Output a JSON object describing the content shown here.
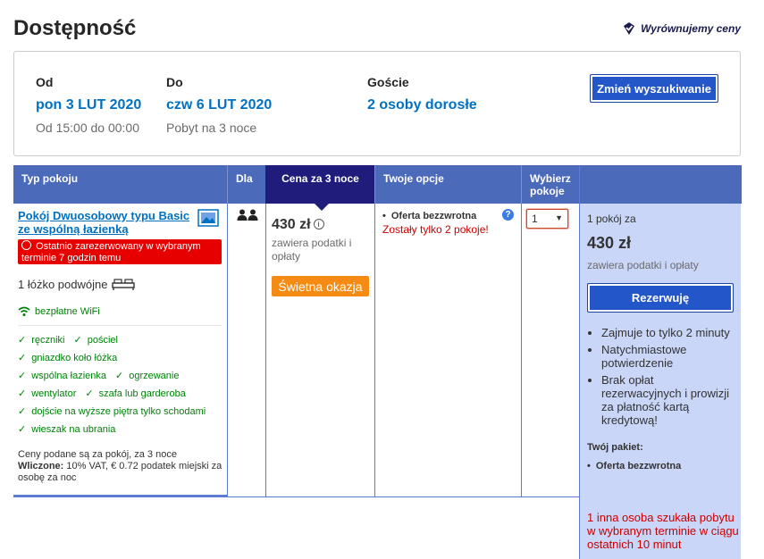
{
  "header": {
    "title": "Dostępność",
    "price_match": "Wyrównujemy ceny"
  },
  "search": {
    "from": {
      "label": "Od",
      "value": "pon 3 LUT 2020",
      "sub": "Od 15:00 do 00:00"
    },
    "to": {
      "label": "Do",
      "value": "czw 6 LUT 2020",
      "sub": "Pobyt na 3 noce"
    },
    "guests": {
      "label": "Goście",
      "value": "2 osoby dorosłe"
    },
    "change_button": "Zmień wyszukiwanie"
  },
  "table": {
    "headers": {
      "room_type": "Typ pokoju",
      "for": "Dla",
      "price": "Cena za 3 noce",
      "options": "Twoje opcje",
      "select": "Wybierz pokoje"
    },
    "room": {
      "name": "Pokój Dwuosobowy typu Basic ze wspólną łazienką",
      "alert": "Ostatnio zarezerwowany w wybranym terminie 7 godzin temu",
      "bed": "1 łóżko podwójne",
      "wifi": "bezpłatne WiFi",
      "facilities": [
        [
          "ręczniki",
          "pościel"
        ],
        [
          "gniazdko koło łóżka"
        ],
        [
          "wspólna łazienka",
          "ogrzewanie"
        ],
        [
          "wentylator",
          "szafa lub garderoba"
        ],
        [
          "dojście na wyższe piętra tylko schodami"
        ],
        [
          "wieszak na ubrania"
        ]
      ],
      "note_line": "Ceny podane są za pokój, za 3 noce",
      "note_included_label": "Wliczone:",
      "note_included": "10% VAT, € 0.72 podatek miejski za osobę za noc"
    },
    "price": {
      "amount": "430 zł",
      "sub": "zawiera podatki i opłaty",
      "badge": "Świetna okazja"
    },
    "options": {
      "item": "Oferta bezzwrotna",
      "warning": "Zostały tylko 2 pokoje!"
    },
    "select": {
      "value": "1"
    }
  },
  "sidebar": {
    "label": "1 pokój za",
    "price": "430 zł",
    "sub": "zawiera podatki i opłaty",
    "reserve_button": "Rezerwuję",
    "perks": [
      "Zajmuje to tylko 2 minuty",
      "Natychmiastowe potwierdzenie",
      "Brak opłat rezerwacyjnych i prowizji za płatność kartą kredytową!"
    ],
    "package_title": "Twój pakiet:",
    "package_item": "Oferta bezzwrotna",
    "warning": "1 inna osoba szukała pobytu w wybranym terminie w ciągu ostatnich 10 minut"
  }
}
